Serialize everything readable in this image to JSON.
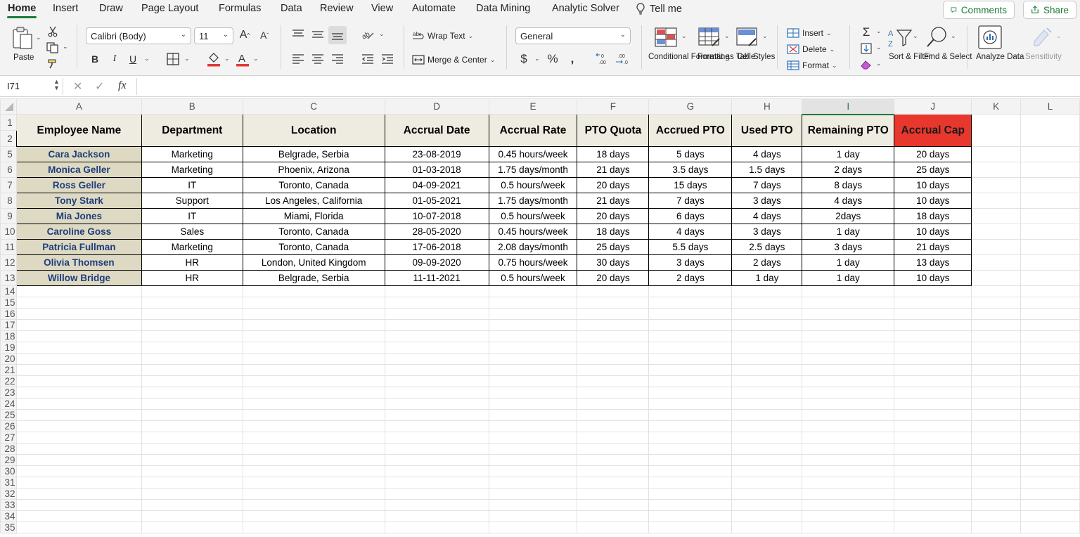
{
  "tabs": [
    "Home",
    "Insert",
    "Draw",
    "Page Layout",
    "Formulas",
    "Data",
    "Review",
    "View",
    "Automate",
    "Data Mining",
    "Analytic Solver"
  ],
  "tell_me": "Tell me",
  "comments_label": "Comments",
  "share_label": "Share",
  "ribbon": {
    "paste": "Paste",
    "font_name": "Calibri (Body)",
    "font_size": "11",
    "wrap_text": "Wrap Text",
    "merge_center": "Merge & Center",
    "number_format": "General",
    "conditional_formatting": "Conditional Formatting",
    "format_as_table": "Format as Table",
    "cell_styles": "Cell Styles",
    "insert": "Insert",
    "delete": "Delete",
    "format": "Format",
    "sort_filter": "Sort & Filter",
    "find_select": "Find & Select",
    "analyze_data": "Analyze Data",
    "sensitivity": "Sensitivity"
  },
  "formula_bar": {
    "name_box": "I71",
    "fx": "fx",
    "value": ""
  },
  "colors": {
    "accent": "#1d7a3a",
    "header_fill": "#eeece1",
    "name_fill": "#ddd9c3",
    "cap_fill": "#e8372c",
    "name_text": "#1f3d7a"
  },
  "columns": [
    "A",
    "B",
    "C",
    "D",
    "E",
    "F",
    "G",
    "H",
    "I",
    "J",
    "K",
    "L"
  ],
  "selected_column": "I",
  "table": {
    "headers": [
      "Employee Name",
      "Department",
      "Location",
      "Accrual Date",
      "Accrual Rate",
      "PTO Quota",
      "Accrued PTO",
      "Used PTO",
      "Remaining PTO",
      "Accrual Cap"
    ],
    "header_rows": [
      "1",
      "2"
    ],
    "rows": [
      {
        "row": "5",
        "cells": [
          "Cara Jackson",
          "Marketing",
          "Belgrade, Serbia",
          "23-08-2019",
          "0.45 hours/week",
          "18 days",
          "5 days",
          "4 days",
          "1 day",
          "20 days"
        ]
      },
      {
        "row": "6",
        "cells": [
          "Monica Geller",
          "Marketing",
          "Phoenix, Arizona",
          "01-03-2018",
          "1.75 days/month",
          "21 days",
          "3.5 days",
          "1.5 days",
          "2 days",
          "25 days"
        ]
      },
      {
        "row": "7",
        "cells": [
          "Ross Geller",
          "IT",
          "Toronto, Canada",
          "04-09-2021",
          "0.5 hours/week",
          "20 days",
          "15 days",
          "7 days",
          "8 days",
          "10 days"
        ]
      },
      {
        "row": "8",
        "cells": [
          "Tony Stark",
          "Support",
          "Los Angeles, California",
          "01-05-2021",
          "1.75 days/month",
          "21 days",
          "7 days",
          "3 days",
          "4 days",
          "10 days"
        ]
      },
      {
        "row": "9",
        "cells": [
          "Mia Jones",
          "IT",
          "Miami, Florida",
          "10-07-2018",
          "0.5 hours/week",
          "20 days",
          "6 days",
          "4 days",
          "2days",
          "18 days"
        ]
      },
      {
        "row": "10",
        "cells": [
          "Caroline Goss",
          "Sales",
          "Toronto, Canada",
          "28-05-2020",
          "0.45 hours/week",
          "18 days",
          "4 days",
          "3 days",
          "1 day",
          "10 days"
        ]
      },
      {
        "row": "11",
        "cells": [
          "Patricia Fullman",
          "Marketing",
          "Toronto, Canada",
          "17-06-2018",
          "2.08 days/month",
          "25 days",
          "5.5 days",
          "2.5 days",
          "3 days",
          "21 days"
        ]
      },
      {
        "row": "12",
        "cells": [
          "Olivia Thomsen",
          "HR",
          "London, United Kingdom",
          "09-09-2020",
          "0.75 hours/week",
          "30 days",
          "3 days",
          "2 days",
          "1 day",
          "13 days"
        ]
      },
      {
        "row": "13",
        "cells": [
          "Willow Bridge",
          "HR",
          "Belgrade, Serbia",
          "11-11-2021",
          "0.5 hours/week",
          "20 days",
          "2 days",
          "1 day",
          "1 day",
          "10 days"
        ]
      }
    ]
  },
  "empty_rows": [
    "14",
    "15",
    "16",
    "17",
    "18",
    "19",
    "20",
    "21",
    "22",
    "23",
    "24",
    "25",
    "26",
    "27",
    "28",
    "29",
    "30",
    "31",
    "32",
    "33",
    "34",
    "35"
  ]
}
